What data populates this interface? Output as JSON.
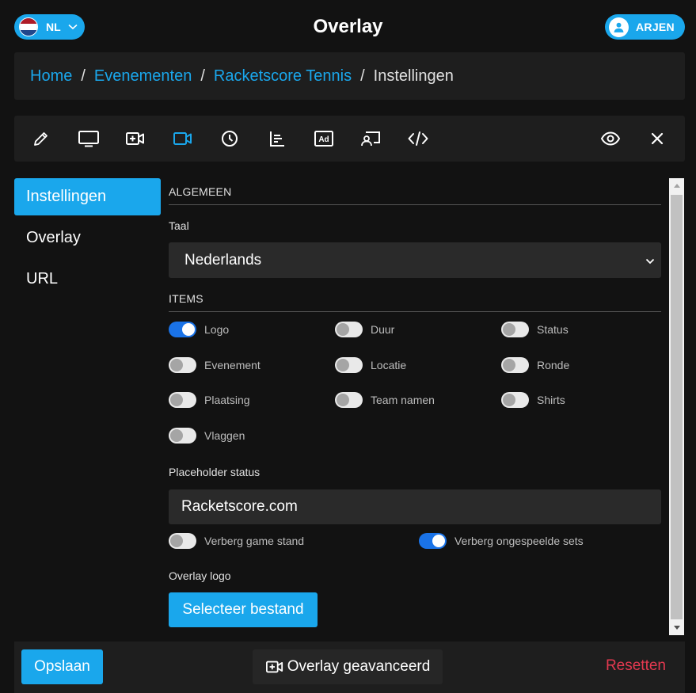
{
  "header": {
    "lang_label": "NL",
    "title": "Overlay",
    "user_name": "ARJEN"
  },
  "breadcrumb": {
    "items": [
      "Home",
      "Evenementen",
      "Racketscore Tennis"
    ],
    "separator": "/",
    "current": "Instellingen"
  },
  "toolbar": {
    "icons": [
      "pencil-icon",
      "monitor-icon",
      "video-plus-icon",
      "video-camera-icon",
      "clock-icon",
      "list-chart-icon",
      "ad-icon",
      "cast-icon",
      "code-icon",
      "eye-icon",
      "close-icon"
    ],
    "active_icon": "video-camera-icon"
  },
  "sidebar": {
    "items": [
      {
        "label": "Instellingen",
        "active": true
      },
      {
        "label": "Overlay",
        "active": false
      },
      {
        "label": "URL",
        "active": false
      }
    ]
  },
  "settings": {
    "general_heading": "ALGEMEEN",
    "language_label": "Taal",
    "language_value": "Nederlands",
    "items_heading": "ITEMS",
    "toggles": [
      {
        "label": "Logo",
        "on": true
      },
      {
        "label": "Duur",
        "on": false
      },
      {
        "label": "Status",
        "on": false
      },
      {
        "label": "Evenement",
        "on": false
      },
      {
        "label": "Locatie",
        "on": false
      },
      {
        "label": "Ronde",
        "on": false
      },
      {
        "label": "Plaatsing",
        "on": false
      },
      {
        "label": "Team namen",
        "on": false
      },
      {
        "label": "Shirts",
        "on": false
      },
      {
        "label": "Vlaggen",
        "on": false
      }
    ],
    "placeholder_label": "Placeholder status",
    "placeholder_value": "Racketscore.com",
    "hide_game_label": "Verberg game stand",
    "hide_game_on": false,
    "hide_sets_label": "Verberg ongespeelde sets",
    "hide_sets_on": true,
    "logo_label": "Overlay logo",
    "select_file_label": "Selecteer bestand"
  },
  "footer": {
    "save_label": "Opslaan",
    "advanced_label": "Overlay geavanceerd",
    "reset_label": "Resetten"
  },
  "colors": {
    "accent": "#1aa7ec",
    "danger": "#e53950",
    "toggle_on": "#1a73e8",
    "background": "#121212",
    "card": "#1e1e1e"
  }
}
